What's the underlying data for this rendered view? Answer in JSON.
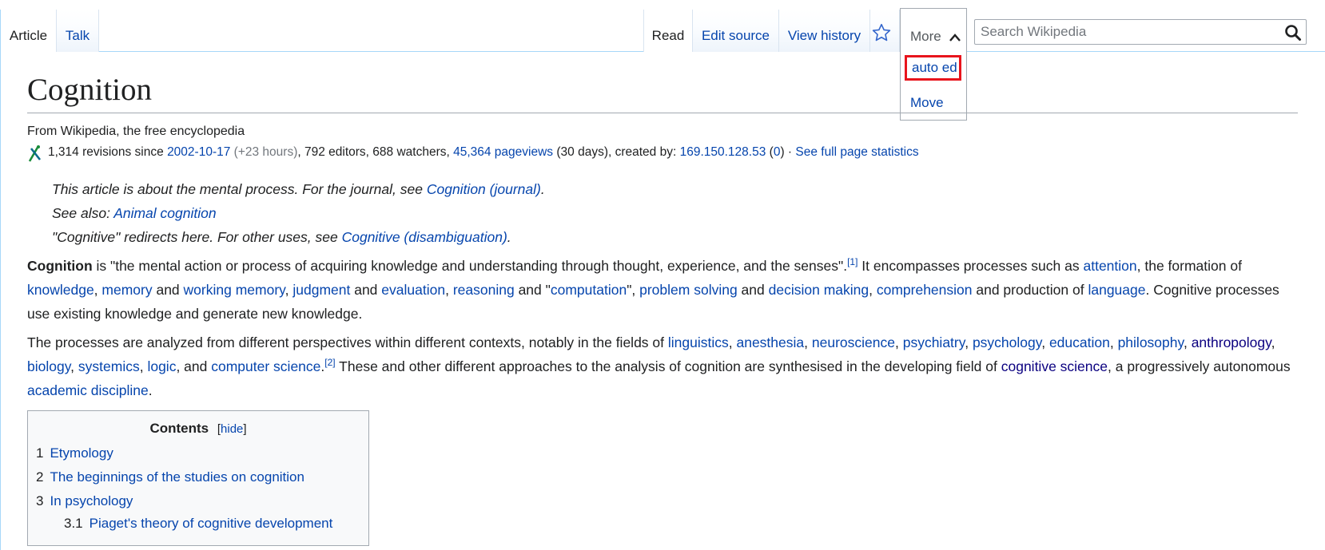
{
  "tabs_left": [
    {
      "label": "Article"
    },
    {
      "label": "Talk"
    }
  ],
  "tabs_right": [
    {
      "label": "Read"
    },
    {
      "label": "Edit source"
    },
    {
      "label": "View history"
    }
  ],
  "watch_icon": "star-icon",
  "more_menu": {
    "label": "More",
    "icon": "chevron-up-icon",
    "items": [
      "auto ed",
      "Move"
    ],
    "highlight_color": "#e8141c"
  },
  "search": {
    "placeholder": "Search Wikipedia",
    "icon": "search-icon"
  },
  "article": {
    "title": "Cognition",
    "from": "From Wikipedia, the free encyclopedia",
    "stats": {
      "revisions": "1,314 revisions since ",
      "since_date": "2002-10-17",
      "since_delta": " (+23 hours)",
      "editors_watchers": ", 792 editors, 688 watchers, ",
      "pageviews": "45,364 pageviews",
      "pageviews_period": " (30 days), created by: ",
      "creator": "169.150.128.53",
      "creator_count": "0",
      "full_stats": "See full page statistics"
    },
    "hatnote1": {
      "text": "This article is about the mental process. For the journal, see ",
      "link": "Cognition (journal)",
      "end": "."
    },
    "hatnote2": {
      "text": "See also: ",
      "link": "Animal cognition"
    },
    "hatnote3": {
      "text": "\"Cognitive\" redirects here. For other uses, see ",
      "link": "Cognitive (disambiguation)",
      "end": "."
    },
    "p1": {
      "bold": "Cognition",
      "t1": " is \"the mental action or process of acquiring knowledge and understanding through thought, experience, and the senses\".",
      "ref1": "[1]",
      "t2": " It encompasses processes such as ",
      "l_attention": "attention",
      "t3": ", the formation of ",
      "l_knowledge": "knowledge",
      "l_memory": "memory",
      "l_working_memory": "working memory",
      "l_judgment": "judgment",
      "l_evaluation": "evaluation",
      "l_reasoning": "reasoning",
      "l_computation": "computation",
      "l_problem_solving": "problem solving",
      "l_decision_making": "decision making",
      "l_comprehension": "comprehension",
      "t_prod": " and production of ",
      "l_language": "language",
      "t_end": ". Cognitive processes use existing knowledge and generate new knowledge."
    },
    "p2": {
      "t1": "The processes are analyzed from different perspectives within different contexts, notably in the fields of ",
      "links1": [
        "linguistics",
        "anesthesia",
        "neuroscience",
        "psychiatry",
        "psychology",
        "education",
        "philosophy",
        "anthropology",
        "biology",
        "systemics",
        "logic"
      ],
      "l_cs": "computer science",
      "ref2": "[2]",
      "t2": " These and other different approaches to the analysis of cognition are synthesised in the developing field of ",
      "l_cogsci": "cognitive science",
      "t3": ", a progressively autonomous ",
      "l_academic": "academic discipline",
      "t4": "."
    }
  },
  "toc": {
    "title": "Contents",
    "hide": "hide",
    "items": [
      {
        "num": "1",
        "label": "Etymology"
      },
      {
        "num": "2",
        "label": "The beginnings of the studies on cognition"
      },
      {
        "num": "3",
        "label": "In psychology"
      },
      {
        "num": "3.1",
        "label": "Piaget's theory of cognitive development"
      }
    ]
  }
}
